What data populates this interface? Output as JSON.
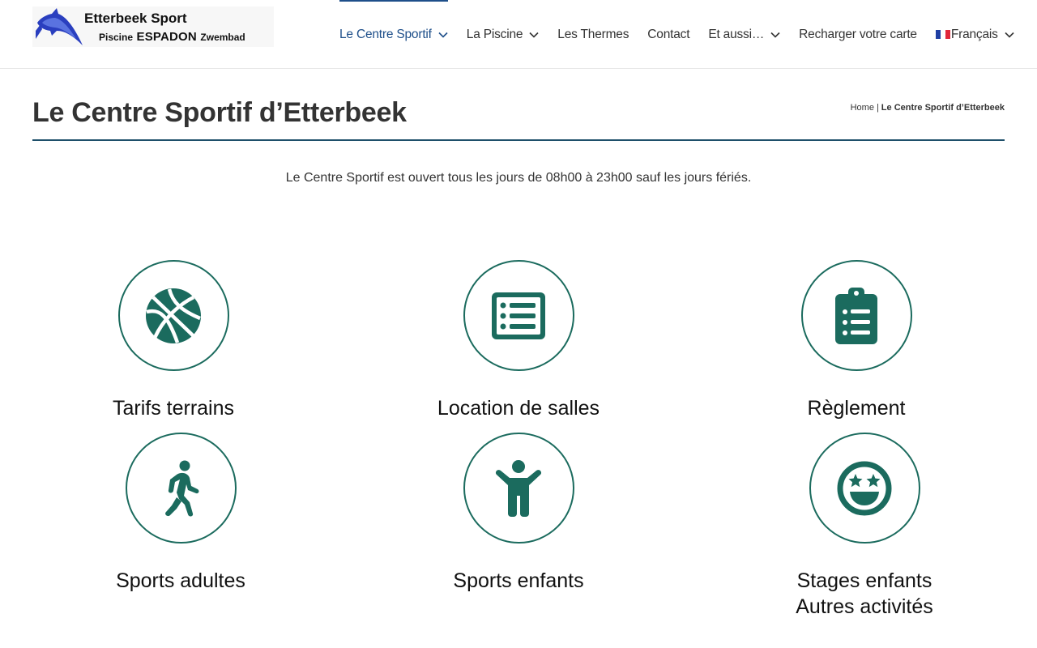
{
  "logo": {
    "title": "Etterbeek Sport",
    "sub_small_left": "Piscine",
    "sub_big": "ESPADON",
    "sub_small_right": "Zwembad"
  },
  "nav": {
    "items": [
      {
        "label": "Le Centre Sportif",
        "has_dropdown": true,
        "active": true
      },
      {
        "label": "La Piscine",
        "has_dropdown": true,
        "active": false
      },
      {
        "label": "Les Thermes",
        "has_dropdown": false,
        "active": false
      },
      {
        "label": "Contact",
        "has_dropdown": false,
        "active": false
      },
      {
        "label": "Et aussi…",
        "has_dropdown": true,
        "active": false
      },
      {
        "label": "Recharger votre carte",
        "has_dropdown": false,
        "active": false
      },
      {
        "label": "Français",
        "has_dropdown": true,
        "active": false,
        "icon": "france-flag-icon"
      }
    ]
  },
  "page": {
    "title": "Le Centre Sportif d’Etterbeek",
    "breadcrumb": {
      "home": "Home",
      "separator": "|",
      "current": "Le Centre Sportif d’Etterbeek"
    },
    "intro": "Le Centre Sportif est ouvert tous les jours de 08h00 à 23h00 sauf les jours fériés."
  },
  "tiles": [
    {
      "label": "Tarifs terrains",
      "icon": "basketball-icon"
    },
    {
      "label": "Location de salles",
      "icon": "list-icon"
    },
    {
      "label": "Règlement",
      "icon": "clipboard-list-icon"
    },
    {
      "label": "Sports adultes",
      "icon": "walking-person-icon"
    },
    {
      "label": "Sports enfants",
      "icon": "child-icon"
    },
    {
      "label": "Stages enfants",
      "label_line2": "Autres activités",
      "icon": "star-eyes-smile-icon"
    }
  ],
  "colors": {
    "accent": "#1e4f8a",
    "icon": "#1b6b5e",
    "title_rule": "#1e4f6a"
  }
}
